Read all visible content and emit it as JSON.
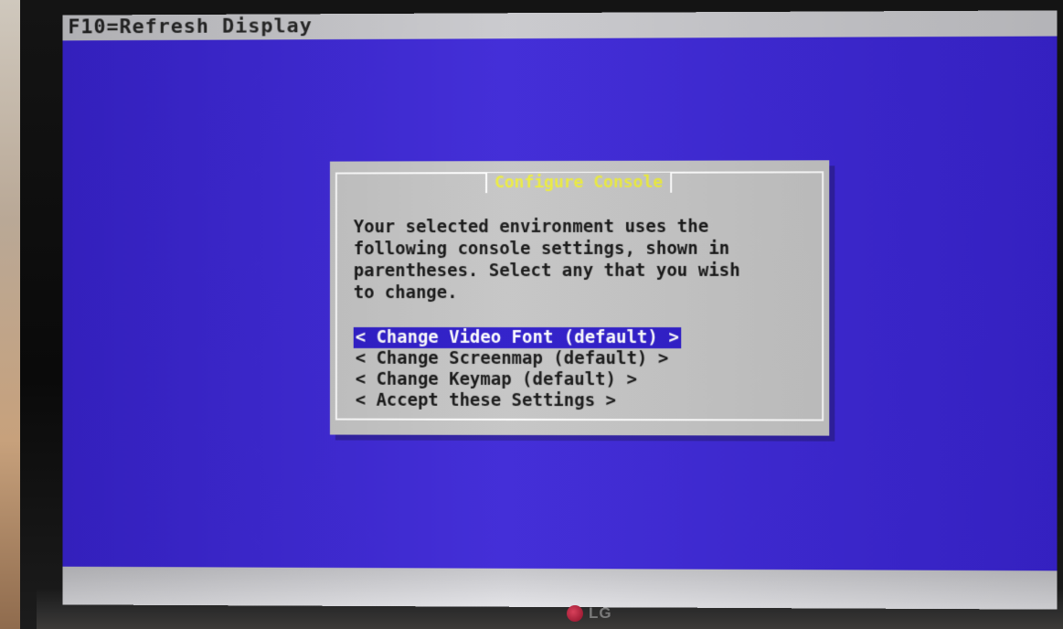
{
  "screen": {
    "top_bar": "F10=Refresh Display",
    "background_color": "#3a24d6"
  },
  "dialog": {
    "title": "Configure Console",
    "title_color": "#ecec3a",
    "message": "Your selected environment uses the\nfollowing console settings, shown in\nparentheses. Select any that you wish\nto change.",
    "menu": [
      {
        "label": "< Change Video Font (default) >",
        "selected": true
      },
      {
        "label": "< Change Screenmap (default) >",
        "selected": false
      },
      {
        "label": "< Change Keymap (default) >",
        "selected": false
      },
      {
        "label": "< Accept these Settings >",
        "selected": false
      }
    ]
  },
  "monitor": {
    "brand": "LG"
  }
}
